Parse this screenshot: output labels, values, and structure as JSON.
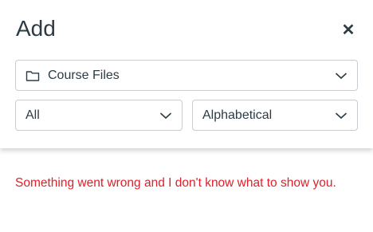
{
  "dialog": {
    "title": "Add",
    "close_icon": "close-icon"
  },
  "source_select": {
    "icon": "folder-icon",
    "value": "Course Files"
  },
  "type_select": {
    "value": "All"
  },
  "sort_select": {
    "value": "Alphabetical"
  },
  "message": {
    "text": "Something went wrong and I don't know what to show you.",
    "color": "#e0202a"
  }
}
